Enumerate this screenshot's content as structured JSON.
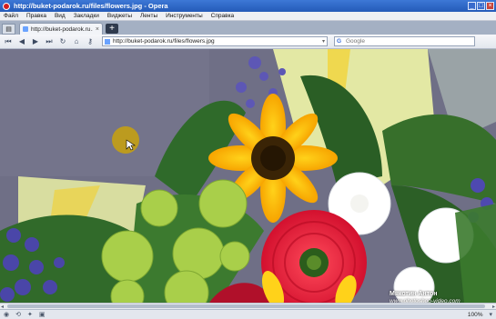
{
  "window": {
    "title": "http://buket-podarok.ru/files/flowers.jpg - Opera",
    "min_label": "_",
    "max_label": "□",
    "close_label": "×"
  },
  "menu": [
    "Файл",
    "Правка",
    "Вид",
    "Закладки",
    "Виджеты",
    "Ленты",
    "Инструменты",
    "Справка"
  ],
  "tabs": [
    {
      "label": "http://buket-podarok.ru...",
      "close": "×"
    }
  ],
  "new_tab_label": "+",
  "toolbar": {
    "address_value": "http://buket-podarok.ru/files/flowers.jpg",
    "search_placeholder": "Google",
    "search_engine_letter": "G"
  },
  "watermark": {
    "name": "Мякотин Антон",
    "site": "www.photoshop-video.com"
  },
  "statusbar": {
    "zoom": "100%"
  },
  "colors": {
    "titlebar": "#245bb8",
    "cursor_highlight": "#c9a20c"
  }
}
